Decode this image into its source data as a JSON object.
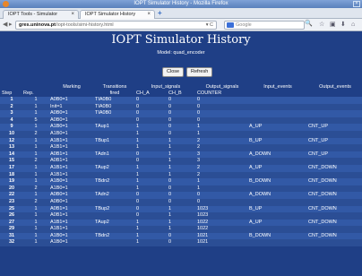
{
  "window": {
    "title": "IOPT Simulator History - Mozilla Firefox",
    "close_glyph": "×"
  },
  "tabs": [
    {
      "label": "IOPT Tools - Simulator",
      "close": "×"
    },
    {
      "label": "IOPT Simulator History",
      "close": "×"
    }
  ],
  "new_tab": "+",
  "nav": {
    "back": "◀",
    "forward": "▸",
    "url_host": "gres.uninova.pt",
    "url_path": "/iopt-tools/simi-history.html",
    "reload": "▾ C",
    "search_placeholder": "Google",
    "search_icon": "🔍",
    "toolbar_icons": [
      "☆",
      "▣",
      "⬇",
      "⌂"
    ]
  },
  "page": {
    "title": "IOPT Simulator History",
    "model": "Model: quad_encoder",
    "close_label": "Close",
    "refresh_label": "Refresh"
  },
  "table": {
    "group_header": [
      "",
      "",
      "Marking",
      "Transitions",
      "Input_signals",
      "Output_signals",
      "Input_events",
      "Output_events"
    ],
    "sub_header": [
      "Step",
      "Rep.",
      "",
      "fired",
      "CH_A",
      "CH_B",
      "COUNTER",
      "",
      ""
    ],
    "rows": [
      [
        "1",
        "1",
        "A0B0=1",
        "TIA0B0",
        "0",
        "0",
        "0",
        "",
        ""
      ],
      [
        "2",
        "1",
        "Init=1",
        "TIA0B0",
        "0",
        "0",
        "0",
        "",
        ""
      ],
      [
        "3",
        "1",
        "A0B0=1",
        "TIA0B0",
        "0",
        "0",
        "0",
        "",
        ""
      ],
      [
        "4",
        "5",
        "A0B0=1",
        "",
        "0",
        "0",
        "0",
        "",
        ""
      ],
      [
        "9",
        "1",
        "A1B0=1",
        "TAup1",
        "1",
        "0",
        "1",
        "A_UP",
        "CNT_UP"
      ],
      [
        "10",
        "2",
        "A1B0=1",
        "",
        "1",
        "0",
        "1",
        "",
        ""
      ],
      [
        "12",
        "1",
        "A1B1=1",
        "TBup1",
        "1",
        "1",
        "2",
        "B_UP",
        "CNT_UP"
      ],
      [
        "13",
        "1",
        "A1B1=1",
        "",
        "1",
        "1",
        "2",
        "",
        ""
      ],
      [
        "14",
        "1",
        "A0B1=1",
        "TAdn1",
        "0",
        "1",
        "3",
        "A_DOWN",
        "CNT_UP"
      ],
      [
        "15",
        "2",
        "A0B1=1",
        "",
        "0",
        "1",
        "3",
        "",
        ""
      ],
      [
        "17",
        "1",
        "A1B1=1",
        "TAup2",
        "1",
        "1",
        "2",
        "A_UP",
        "CNT_DOWN"
      ],
      [
        "18",
        "1",
        "A1B1=1",
        "",
        "1",
        "1",
        "2",
        "",
        ""
      ],
      [
        "19",
        "1",
        "A1B0=1",
        "TBdn2",
        "1",
        "0",
        "1",
        "B_DOWN",
        "CNT_DOWN"
      ],
      [
        "20",
        "2",
        "A1B0=1",
        "",
        "1",
        "0",
        "1",
        "",
        ""
      ],
      [
        "22",
        "1",
        "A0B0=1",
        "TAdn2",
        "0",
        "0",
        "0",
        "A_DOWN",
        "CNT_DOWN"
      ],
      [
        "23",
        "2",
        "A0B0=1",
        "",
        "0",
        "0",
        "0",
        "",
        ""
      ],
      [
        "25",
        "1",
        "A0B1=1",
        "TBup2",
        "0",
        "1",
        "1023",
        "B_UP",
        "CNT_DOWN"
      ],
      [
        "26",
        "1",
        "A0B1=1",
        "",
        "0",
        "1",
        "1023",
        "",
        ""
      ],
      [
        "27",
        "1",
        "A1B1=1",
        "TAup2",
        "1",
        "1",
        "1022",
        "A_UP",
        "CNT_DOWN"
      ],
      [
        "29",
        "1",
        "A1B1=1",
        "",
        "1",
        "1",
        "1022",
        "",
        ""
      ],
      [
        "31",
        "1",
        "A1B0=1",
        "TBdn2",
        "1",
        "0",
        "1021",
        "B_DOWN",
        "CNT_DOWN"
      ],
      [
        "32",
        "1",
        "A1B0=1",
        "",
        "1",
        "0",
        "1021",
        "",
        ""
      ]
    ]
  }
}
